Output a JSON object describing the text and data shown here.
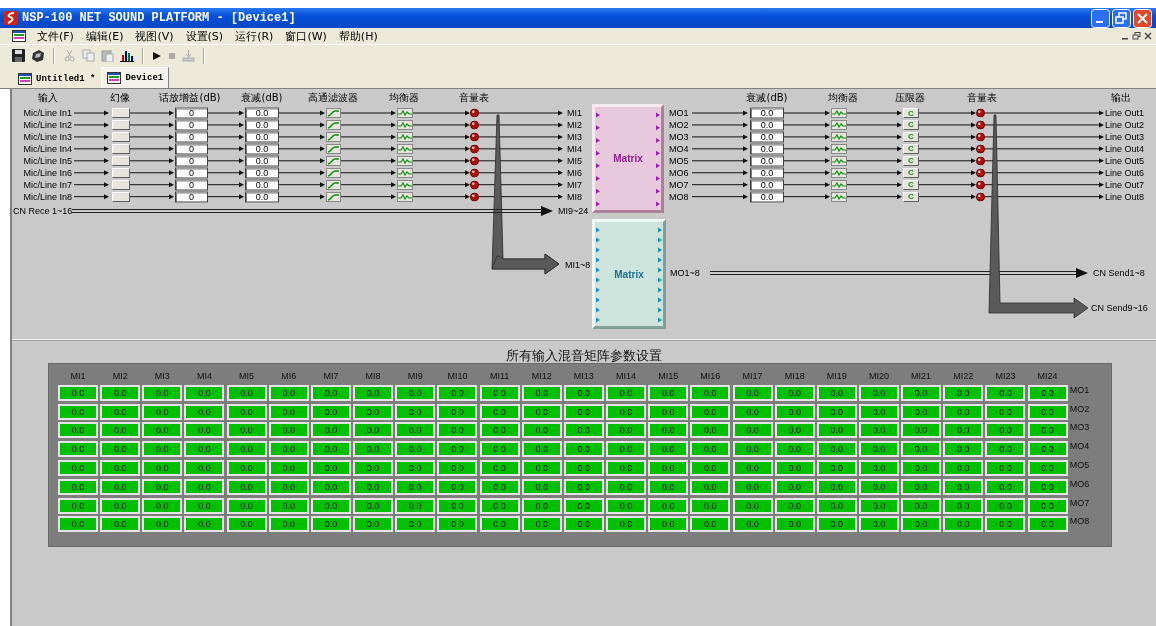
{
  "window": {
    "title": "NSP-100 NET SOUND PLATFORM - [Device1]"
  },
  "menu": [
    "文件(F)",
    "编辑(E)",
    "视图(V)",
    "设置(S)",
    "运行(R)",
    "窗口(W)",
    "帮助(H)"
  ],
  "tabs": [
    {
      "label": "Untitled1 *",
      "selected": false
    },
    {
      "label": "Device1",
      "selected": true
    }
  ],
  "diagram": {
    "input_headers": [
      "输入",
      "幻像",
      "话放增益(dB)",
      "衰减(dB)",
      "高通滤波器",
      "均衡器",
      "音量表"
    ],
    "inputs": [
      {
        "name": "Mic/Line In1",
        "gain": "0",
        "attenuation": "0.0",
        "bus": "MI1"
      },
      {
        "name": "Mic/Line In2",
        "gain": "0",
        "attenuation": "0.0",
        "bus": "MI2"
      },
      {
        "name": "Mic/Line In3",
        "gain": "0",
        "attenuation": "0.0",
        "bus": "MI3"
      },
      {
        "name": "Mic/Line In4",
        "gain": "0",
        "attenuation": "0.0",
        "bus": "MI4"
      },
      {
        "name": "Mic/Line In5",
        "gain": "0",
        "attenuation": "0.0",
        "bus": "MI5"
      },
      {
        "name": "Mic/Line In6",
        "gain": "0",
        "attenuation": "0.0",
        "bus": "MI6"
      },
      {
        "name": "Mic/Line In7",
        "gain": "0",
        "attenuation": "0.0",
        "bus": "MI7"
      },
      {
        "name": "Mic/Line In8",
        "gain": "0",
        "attenuation": "0.0",
        "bus": "MI8"
      }
    ],
    "network_in": {
      "label": "CN Rece 1~16",
      "bus": "MI9~24"
    },
    "matrices": [
      {
        "label": "Matrix"
      },
      {
        "label": "Matrix",
        "input": "MI1~8",
        "output": "MO1~8"
      }
    ],
    "output_headers": [
      "衰减(dB)",
      "均衡器",
      "压限器",
      "音量表",
      "输出"
    ],
    "outputs": [
      {
        "source": "MO1",
        "attenuation": "0.0",
        "compressor": "C",
        "name": "Line Out1"
      },
      {
        "source": "MO2",
        "attenuation": "0.0",
        "compressor": "C",
        "name": "Line Out2"
      },
      {
        "source": "MO3",
        "attenuation": "0.0",
        "compressor": "C",
        "name": "Line Out3"
      },
      {
        "source": "MO4",
        "attenuation": "0.0",
        "compressor": "C",
        "name": "Line Out4"
      },
      {
        "source": "MO5",
        "attenuation": "0.0",
        "compressor": "C",
        "name": "Line Out5"
      },
      {
        "source": "MO6",
        "attenuation": "0.0",
        "compressor": "C",
        "name": "Line Out6"
      },
      {
        "source": "MO7",
        "attenuation": "0.0",
        "compressor": "C",
        "name": "Line Out7"
      },
      {
        "source": "MO8",
        "attenuation": "0.0",
        "compressor": "C",
        "name": "Line Out8"
      }
    ],
    "network_out": [
      "CN Send1~8",
      "CN Send9~16"
    ]
  },
  "mix_matrix": {
    "title": "所有输入混音矩阵参数设置",
    "columns": [
      "MI1",
      "MI2",
      "MI3",
      "MI4",
      "MI5",
      "MI6",
      "MI7",
      "MI8",
      "MI9",
      "MI10",
      "MI11",
      "MI12",
      "MI13",
      "MI14",
      "MI15",
      "MI16",
      "MI17",
      "MI18",
      "MI19",
      "MI20",
      "MI21",
      "MI22",
      "MI23",
      "MI24"
    ],
    "rows": [
      {
        "label": "MO1",
        "cells": [
          "0.0",
          "0.0",
          "0.0",
          "0.0",
          "0.0",
          "0.0",
          "0.0",
          "0.0",
          "0.0",
          "0.0",
          "0.0",
          "0.0",
          "0.0",
          "0.0",
          "0.0",
          "0.0",
          "0.0",
          "0.0",
          "0.0",
          "0.0",
          "0.0",
          "0.0",
          "0.0",
          "0.0"
        ]
      },
      {
        "label": "MO2",
        "cells": [
          "0.0",
          "0.0",
          "0.0",
          "0.0",
          "0.0",
          "0.0",
          "0.0",
          "0.0",
          "0.0",
          "0.0",
          "0.0",
          "0.0",
          "0.0",
          "0.0",
          "0.0",
          "0.0",
          "0.0",
          "0.0",
          "0.0",
          "0.0",
          "0.0",
          "0.0",
          "0.0",
          "0.0"
        ]
      },
      {
        "label": "MO3",
        "cells": [
          "0.0",
          "0.0",
          "0.0",
          "0.0",
          "0.0",
          "0.0",
          "0.0",
          "0.0",
          "0.0",
          "0.0",
          "0.0",
          "0.0",
          "0.0",
          "0.0",
          "0.0",
          "0.0",
          "0.0",
          "0.0",
          "0.0",
          "0.0",
          "0.0",
          "0.0",
          "0.0",
          "0.0"
        ]
      },
      {
        "label": "MO4",
        "cells": [
          "0.0",
          "0.0",
          "0.0",
          "0.0",
          "0.0",
          "0.0",
          "0.0",
          "0.0",
          "0.0",
          "0.0",
          "0.0",
          "0.0",
          "0.0",
          "0.0",
          "0.0",
          "0.0",
          "0.0",
          "0.0",
          "0.0",
          "0.0",
          "0.0",
          "0.0",
          "0.0",
          "0.0"
        ]
      },
      {
        "label": "MO5",
        "cells": [
          "0.0",
          "0.0",
          "0.0",
          "0.0",
          "0.0",
          "0.0",
          "0.0",
          "0.0",
          "0.0",
          "0.0",
          "0.0",
          "0.0",
          "0.0",
          "0.0",
          "0.0",
          "0.0",
          "0.0",
          "0.0",
          "0.0",
          "0.0",
          "0.0",
          "0.0",
          "0.0",
          "0.0"
        ]
      },
      {
        "label": "MO6",
        "cells": [
          "0.0",
          "0.0",
          "0.0",
          "0.0",
          "0.0",
          "0.0",
          "0.0",
          "0.0",
          "0.0",
          "0.0",
          "0.0",
          "0.0",
          "0.0",
          "0.0",
          "0.0",
          "0.0",
          "0.0",
          "0.0",
          "0.0",
          "0.0",
          "0.0",
          "0.0",
          "0.0",
          "0.0"
        ]
      },
      {
        "label": "MO7",
        "cells": [
          "0.0",
          "0.0",
          "0.0",
          "0.0",
          "0.0",
          "0.0",
          "0.0",
          "0.0",
          "0.0",
          "0.0",
          "0.0",
          "0.0",
          "0.0",
          "0.0",
          "0.0",
          "0.0",
          "0.0",
          "0.0",
          "0.0",
          "0.0",
          "0.0",
          "0.0",
          "0.0",
          "0.0"
        ]
      },
      {
        "label": "MO8",
        "cells": [
          "0.0",
          "0.0",
          "0.0",
          "0.0",
          "0.0",
          "0.0",
          "0.0",
          "0.0",
          "0.0",
          "0.0",
          "0.0",
          "0.0",
          "0.0",
          "0.0",
          "0.0",
          "0.0",
          "0.0",
          "0.0",
          "0.0",
          "0.0",
          "0.0",
          "0.0",
          "0.0",
          "0.0"
        ]
      }
    ]
  }
}
